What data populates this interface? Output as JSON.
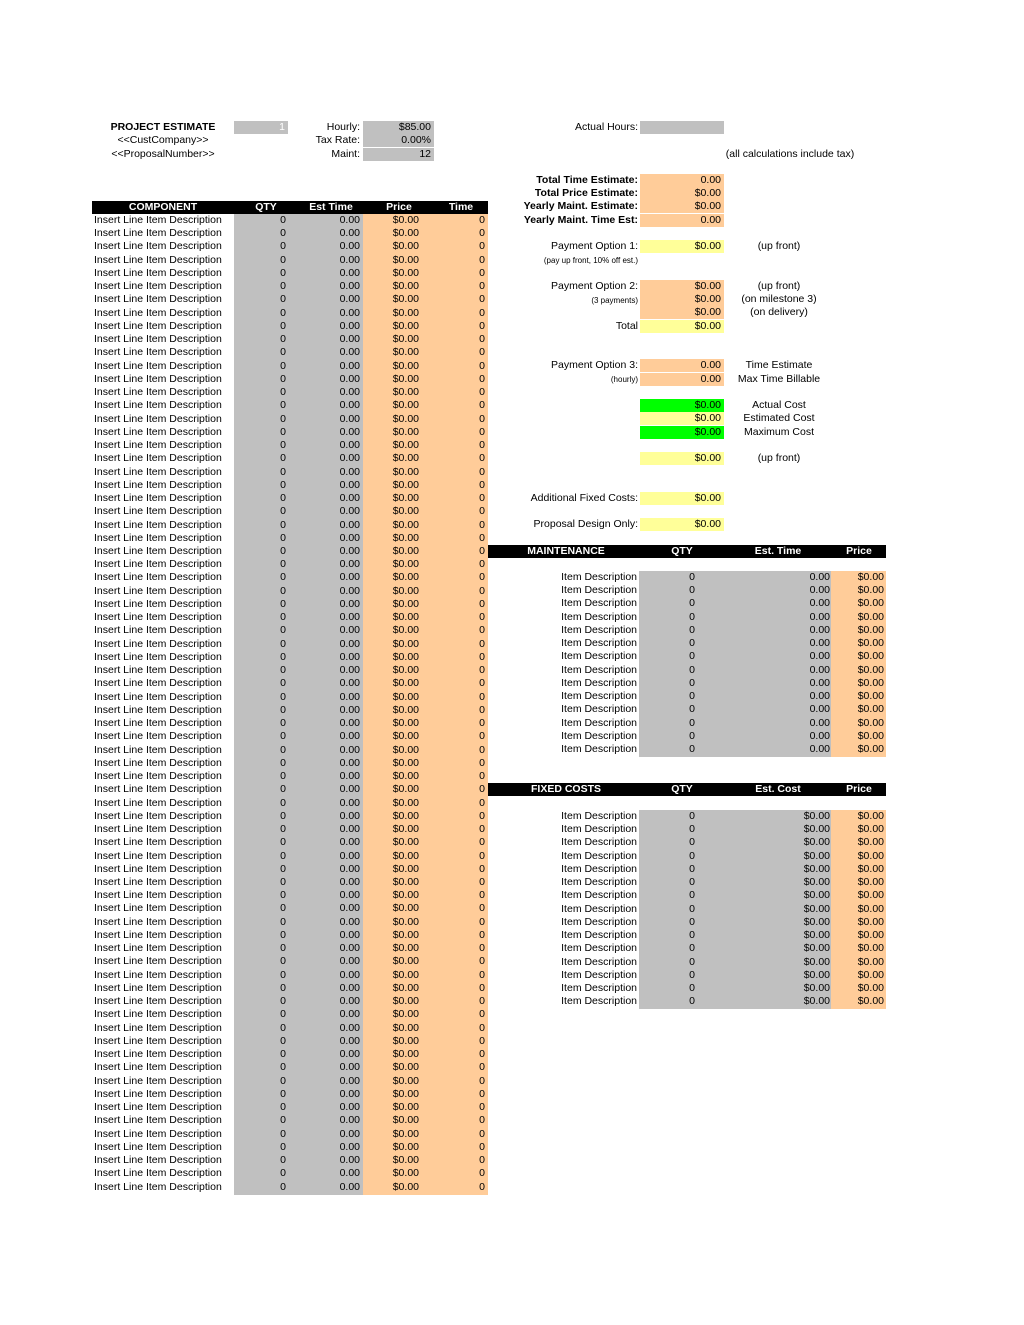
{
  "header": {
    "title": "PROJECT ESTIMATE",
    "company": "<<CustCompany>>",
    "proposal_number": "<<ProposalNumber>>",
    "estimate_number": "1",
    "hourly_label": "Hourly:",
    "hourly_value": "$85.00",
    "tax_label": "Tax Rate:",
    "tax_value": "0.00%",
    "maint_label": "Maint:",
    "maint_value": "12",
    "actual_hours_label": "Actual Hours:",
    "actual_hours_value": "",
    "tax_note": "(all calculations include tax)"
  },
  "totals": {
    "time_label": "Total Time Estimate:",
    "time_value": "0.00",
    "price_label": "Total Price Estimate:",
    "price_value": "$0.00",
    "maint_label": "Yearly Maint. Estimate:",
    "maint_value": "$0.00",
    "maint_time_label": "Yearly Maint. Time Est:",
    "maint_time_value": "0.00"
  },
  "payment1": {
    "label": "Payment Option 1:",
    "sub": "(pay up front, 10% off est.)",
    "value": "$0.00",
    "note": "(up front)"
  },
  "payment2": {
    "label": "Payment Option 2:",
    "sub": "(3 payments)",
    "values": [
      "$0.00",
      "$0.00",
      "$0.00"
    ],
    "notes": [
      "(up front)",
      "(on milestone 3)",
      "(on delivery)"
    ],
    "total_label": "Total",
    "total_value": "$0.00"
  },
  "payment3": {
    "label": "Payment Option 3:",
    "sub": "(hourly)",
    "values": [
      "0.00",
      "0.00"
    ],
    "notes": [
      "Time Estimate",
      "Max Time Billable"
    ],
    "costs": [
      {
        "value": "$0.00",
        "note": "Actual Cost",
        "color": "#00ff00"
      },
      {
        "value": "$0.00",
        "note": "Estimated Cost",
        "color": "#ffff99"
      },
      {
        "value": "$0.00",
        "note": "Maximum Cost",
        "color": "#00ff00"
      }
    ],
    "upfront_value": "$0.00",
    "upfront_note": "(up front)"
  },
  "additional": {
    "fixed_label": "Additional Fixed Costs:",
    "fixed_value": "$0.00",
    "design_label": "Proposal Design Only:",
    "design_value": "$0.00"
  },
  "component_table": {
    "headers": [
      "COMPONENT",
      "QTY",
      "Est Time",
      "Price",
      "Time"
    ],
    "row_count": 74,
    "row": {
      "description": "Insert Line Item Description",
      "qty": "0",
      "est_time": "0.00",
      "price": "$0.00",
      "time": "0"
    }
  },
  "maintenance_table": {
    "headers": [
      "MAINTENANCE",
      "QTY",
      "Est. Time",
      "Price"
    ],
    "row_count": 14,
    "row": {
      "description": "Item Description",
      "qty": "0",
      "est_time": "0.00",
      "price": "$0.00"
    }
  },
  "fixed_costs_table": {
    "headers": [
      "FIXED COSTS",
      "QTY",
      "Est. Cost",
      "Price"
    ],
    "row_count": 15,
    "row": {
      "description": "Item Description",
      "qty": "0",
      "est_cost": "$0.00",
      "price": "$0.00"
    }
  },
  "colors": {
    "input_gray": "#c0c0c0",
    "calc_orange": "#ffcc99",
    "highlight_yellow": "#ffff99",
    "status_green": "#00ff00",
    "header_black": "#000000"
  }
}
